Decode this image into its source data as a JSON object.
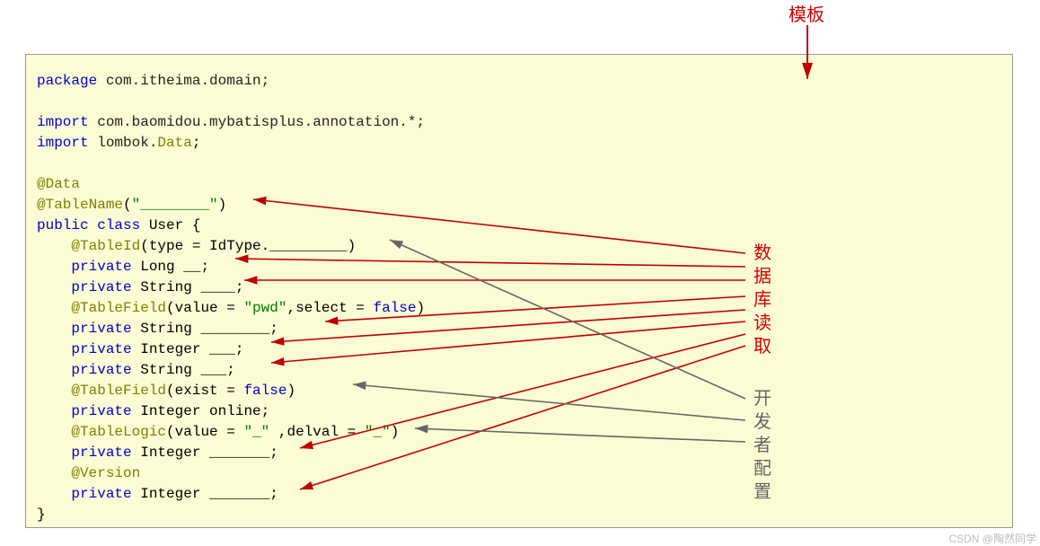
{
  "top_label": "模板",
  "side_red": [
    "数",
    "据",
    "库",
    "读",
    "取"
  ],
  "side_gray": [
    "开",
    "发",
    "者",
    "配",
    "置"
  ],
  "watermark": "CSDN @陶然同学",
  "code": {
    "l1_kw": "package",
    "l1_pkg": " com.itheima.domain;",
    "l2_kw": "import",
    "l2_pkg": " com.baomidou.mybatisplus.annotation.*;",
    "l3_kw": "import",
    "l3_pkg": " lombok.",
    "l3_ann": "Data",
    "l3_end": ";",
    "l4_ann": "@Data",
    "l5_ann": "@TableName",
    "l5_p1": "(",
    "l5_str": "\"________\"",
    "l5_p2": ")",
    "l6": "public class User {",
    "l6_kw1": "public",
    "l6_kw2": " class",
    "l6_rest": " User {",
    "l7_pad": "    ",
    "l7_ann": "@TableId",
    "l7_p": "(type = IdType._________)",
    "l8_pad": "    ",
    "l8_kw": "private",
    "l8_rest": " Long __;",
    "l9_pad": "    ",
    "l9_kw": "private",
    "l9_rest": " String ____;",
    "l10_pad": "    ",
    "l10_ann": "@TableField",
    "l10_p1": "(value = ",
    "l10_str1": "\"pwd\"",
    "l10_p2": ",select = ",
    "l10_kw": "false",
    "l10_p3": ")",
    "l11_pad": "    ",
    "l11_kw": "private",
    "l11_rest": " String ________;",
    "l12_pad": "    ",
    "l12_kw": "private",
    "l12_rest": " Integer ___;",
    "l13_pad": "    ",
    "l13_kw": "private",
    "l13_rest": " String ___;",
    "l14_pad": "    ",
    "l14_ann": "@TableField",
    "l14_p1": "(exist = ",
    "l14_kw": "false",
    "l14_p2": ")",
    "l15_pad": "    ",
    "l15_kw": "private",
    "l15_rest": " Integer online;",
    "l16_pad": "    ",
    "l16_ann": "@TableLogic",
    "l16_p1": "(value = ",
    "l16_str1": "\"_\"",
    "l16_p2": " ,delval = ",
    "l16_str2": "\"_\"",
    "l16_p3": ")",
    "l17_pad": "    ",
    "l17_kw": "private",
    "l17_rest": " Integer _______;",
    "l18_pad": "    ",
    "l18_ann": "@Version",
    "l19_pad": "    ",
    "l19_kw": "private",
    "l19_rest": " Integer _______;",
    "l20": "}"
  }
}
